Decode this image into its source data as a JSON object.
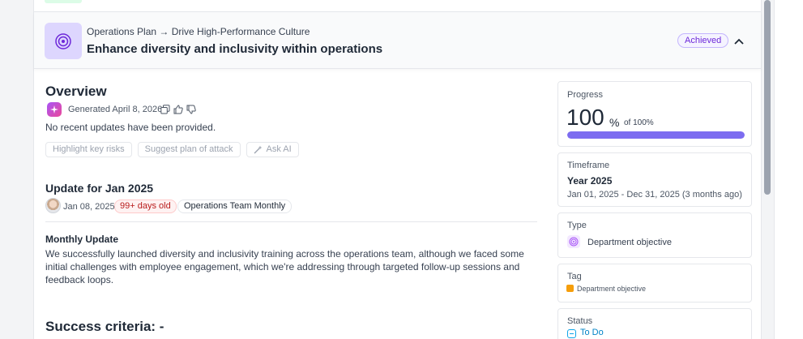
{
  "header": {
    "breadcrumb": "Operations Plan → Drive High-Performance Culture",
    "title": "Enhance diversity and inclusivity within operations",
    "status_badge": "Achieved"
  },
  "overview": {
    "title": "Overview",
    "generated": "Generated April 8, 2026",
    "empty_text": "No recent updates have been provided.",
    "actions": [
      "Highlight key risks",
      "Suggest plan of attack",
      "Ask AI"
    ]
  },
  "update": {
    "title": "Update for Jan 2025",
    "date": "Jan 08, 2025",
    "age_badge": "99+ days old",
    "team_badge": "Operations Team Monthly",
    "section_label": "Monthly Update",
    "body": "We successfully launched diversity and inclusivity training across the operations team, although we faced some initial challenges with employee engagement, which we're addressing through targeted follow-up sessions and feedback loops."
  },
  "success_criteria": "Success criteria: -",
  "sidebar": {
    "progress": {
      "label": "Progress",
      "value": "100",
      "unit": "%",
      "of": "of 100%",
      "fill": 1.0
    },
    "timeframe": {
      "label": "Timeframe",
      "value": "Year 2025",
      "range": "Jan 01, 2025 - Dec 31, 2025 (3 months ago)"
    },
    "type": {
      "label": "Type",
      "value": "Department objective"
    },
    "tag": {
      "label": "Tag",
      "value": "Department objective"
    },
    "status": {
      "label": "Status",
      "value": "To Do"
    }
  },
  "colors": {
    "accent": "#7c6cf0",
    "achieved": "#6d28d9",
    "overdue": "#b91c1c",
    "tag": "#f59e0b",
    "status": "#0284c7"
  }
}
